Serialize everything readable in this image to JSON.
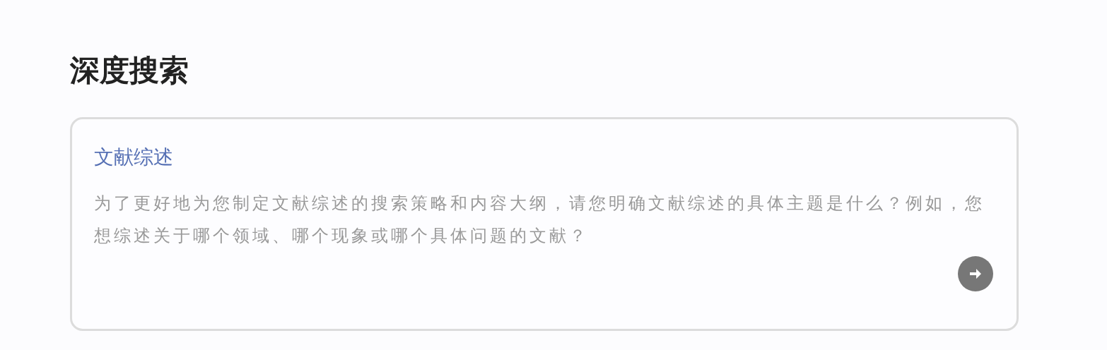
{
  "title": "深度搜索",
  "card": {
    "heading": "文献综述",
    "text": "为了更好地为您制定文献综述的搜索策略和内容大纲，请您明确文献综述的具体主题是什么？例如，您想综述关于哪个领域、哪个现象或哪个具体问题的文献？"
  }
}
